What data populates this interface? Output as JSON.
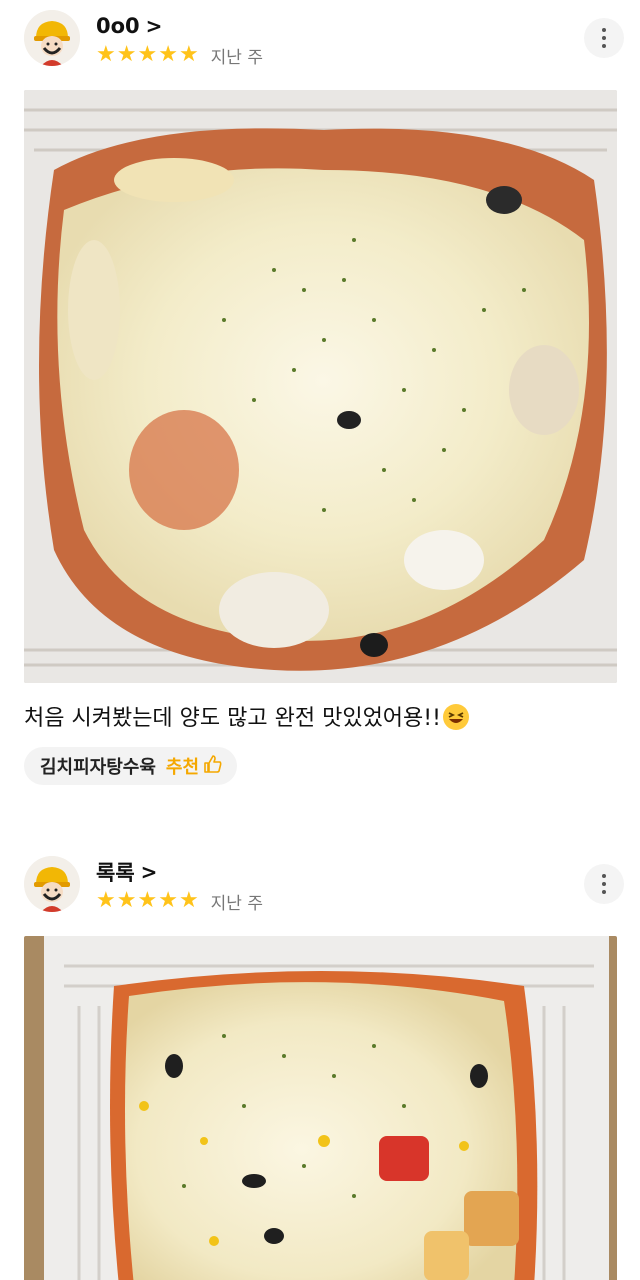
{
  "reviews": [
    {
      "username": "0o0",
      "chevron": ">",
      "rating": 5,
      "stars": [
        "★",
        "★",
        "★",
        "★",
        "★"
      ],
      "date": "지난 주",
      "photo_icon": "food-photo-cheese-tangsuyuk",
      "text": "처음 시켜봤는데 양도 많고 완전 맛있었어용!!",
      "emoji_icon": "grinning-squinting-face-icon",
      "menu_name": "김치피자탕수육",
      "recommend_label": "추천",
      "recommend_icon": "thumbs-up-icon"
    },
    {
      "username": "록록",
      "chevron": ">",
      "rating": 5,
      "stars": [
        "★",
        "★",
        "★",
        "★",
        "★"
      ],
      "date": "지난 주",
      "photo_icon": "food-photo-cheese-tangsuyuk"
    }
  ],
  "colors": {
    "star": "#ffc31a",
    "recommend": "#f5a800",
    "chip_bg": "#f3f3f3",
    "date_text": "#777777"
  }
}
